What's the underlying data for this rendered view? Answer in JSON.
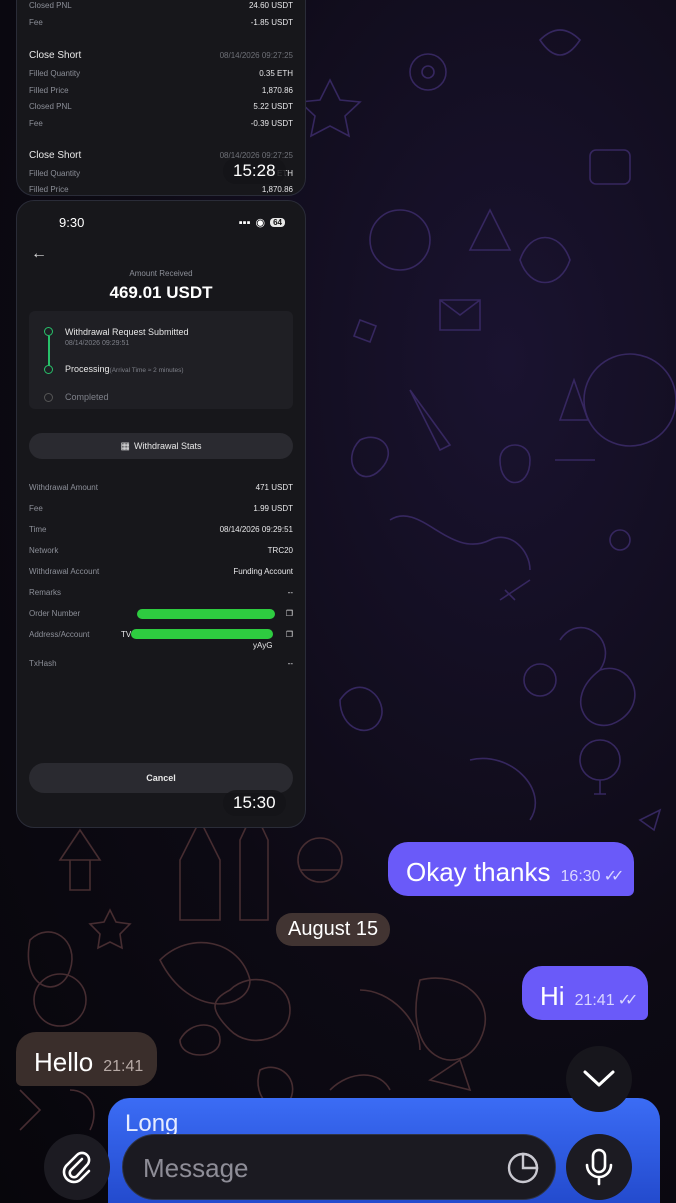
{
  "colors": {
    "outgoing_bubble": "#6a5af9",
    "incoming_bubble": "#3a2e2b",
    "reply_panel": "#3b6cf5",
    "success_green": "#28c06a"
  },
  "image1": {
    "rows_top": [
      {
        "label": "Closed PNL",
        "value": "24.60 USDT"
      },
      {
        "label": "Fee",
        "value": "-1.85 USDT"
      }
    ],
    "trade1": {
      "title": "Close Short",
      "timestamp": "08/14/2026 09:27:25",
      "rows": [
        {
          "label": "Filled Quantity",
          "value": "0.35 ETH"
        },
        {
          "label": "Filled Price",
          "value": "1,870.86"
        },
        {
          "label": "Closed PNL",
          "value": "5.22 USDT"
        },
        {
          "label": "Fee",
          "value": "-0.39 USDT"
        }
      ]
    },
    "trade2": {
      "title": "Close Short",
      "timestamp": "08/14/2026 09:27:25",
      "rows": [
        {
          "label": "Filled Quantity",
          "value": "0.35 ETH"
        },
        {
          "label": "Filled Price",
          "value": "1,870.86"
        }
      ]
    },
    "sent_time": "15:28"
  },
  "image2": {
    "status_time": "9:30",
    "battery": "64",
    "amount_label": "Amount Received",
    "amount": "469.01 USDT",
    "steps": {
      "submitted": "Withdrawal Request Submitted",
      "submitted_time": "08/14/2026 09:29:51",
      "processing": "Processing",
      "processing_note": "(Arrival Time ≈ 2 minutes)",
      "completed": "Completed"
    },
    "stats_button": "Withdrawal Stats",
    "details": [
      {
        "label": "Withdrawal Amount",
        "value": "471 USDT"
      },
      {
        "label": "Fee",
        "value": "1.99 USDT"
      },
      {
        "label": "Time",
        "value": "08/14/2026 09:29:51"
      },
      {
        "label": "Network",
        "value": "TRC20"
      },
      {
        "label": "Withdrawal Account",
        "value": "Funding Account"
      },
      {
        "label": "Remarks",
        "value": "--"
      },
      {
        "label": "Order Number",
        "value": ""
      },
      {
        "label": "Address/Account",
        "value": "TV"
      },
      {
        "label": "TxHash",
        "value": "--"
      }
    ],
    "address_suffix": "yAyG",
    "cancel_button": "Cancel",
    "sent_time": "15:30"
  },
  "messages": {
    "okay": {
      "text": "Okay thanks",
      "time": "16:30"
    },
    "date_separator": "August 15",
    "hi": {
      "text": "Hi",
      "time": "21:41"
    },
    "hello": {
      "text": "Hello",
      "time": "21:41"
    }
  },
  "composer": {
    "reply_preview": "Long",
    "placeholder": "Message"
  }
}
